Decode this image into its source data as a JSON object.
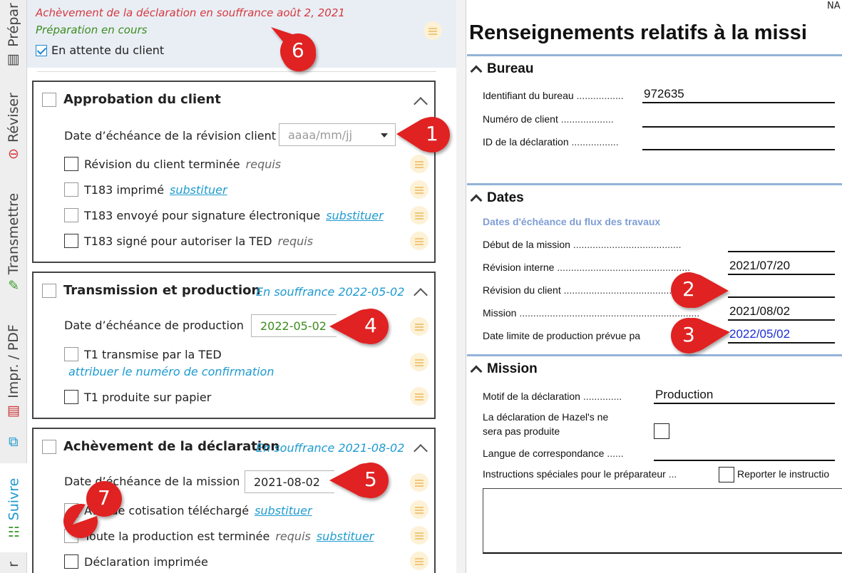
{
  "rail": {
    "tabs": [
      {
        "label": "Prépar",
        "icon": "chart-icon"
      },
      {
        "label": "Réviser",
        "icon": "minus-circle-icon"
      },
      {
        "label": "Transmettre",
        "icon": "send-icon"
      },
      {
        "label": "Impr. / PDF",
        "icon": "pdf-icon"
      },
      {
        "label": "",
        "icon": "copy-icon"
      },
      {
        "label": "Suivre",
        "icon": "workflow-icon"
      },
      {
        "label": "r",
        "icon": ""
      }
    ]
  },
  "status": {
    "overdue_text": "Achèvement de la déclaration en souffrance  août 2, 2021",
    "prep_text": "Préparation en cours",
    "waiting_label": "En attente du client"
  },
  "sections": [
    {
      "title": "Approbation du client",
      "status": "",
      "date_label": "Date d’échéance de la révision client",
      "date_placeholder": "aaaa/mm/jj",
      "items": [
        {
          "label": "Révision du client terminée",
          "tag": "requis",
          "link": ""
        },
        {
          "label": "T183 imprimé",
          "tag": "",
          "link": "substituer"
        },
        {
          "label": "T183 envoyé pour signature électronique",
          "tag": "",
          "link": "substituer"
        },
        {
          "label": "T183 signé pour autoriser la TED",
          "tag": "requis",
          "link": ""
        }
      ]
    },
    {
      "title": "Transmission et production",
      "status": "En souffrance 2022-05-02",
      "date_label": "Date d’échéance de production",
      "date_value": "2022-05-02",
      "items": [
        {
          "label": "T1 transmise par la TED",
          "tag": "",
          "link": "",
          "sublink": "attribuer le numéro de confirmation"
        },
        {
          "label": "T1 produite sur papier",
          "tag": "",
          "link": ""
        }
      ]
    },
    {
      "title": "Achèvement de la déclaration",
      "status": "En souffrance 2021-08-02",
      "date_label": "Date d’échéance de la mission",
      "date_value": "2021-08-02",
      "items": [
        {
          "label": "Avis de cotisation téléchargé",
          "tag": "",
          "link": "substituer"
        },
        {
          "label": "Toute la production est terminée",
          "tag": "requis",
          "link": "substituer"
        },
        {
          "label": "Déclaration imprimée",
          "tag": "",
          "link": ""
        }
      ]
    }
  ],
  "form": {
    "corner_text": "NA",
    "title": "Renseignements relatifs à la missi",
    "bureau": {
      "heading": "Bureau",
      "fields": [
        {
          "label": "Identifiant du bureau",
          "value": "972635"
        },
        {
          "label": "Numéro de client",
          "value": ""
        },
        {
          "label": "ID de la déclaration",
          "value": ""
        }
      ]
    },
    "dates": {
      "heading": "Dates",
      "subheading": "Dates d'échéance du flux des travaux",
      "fields": [
        {
          "label": "Début de la mission",
          "value": ""
        },
        {
          "label": "Révision interne",
          "value": "2021/07/20"
        },
        {
          "label": "Révision du client",
          "value": ""
        },
        {
          "label": "Mission",
          "value": "2021/08/02"
        },
        {
          "label": "Date limite de production prévue pa",
          "value": "2022/05/02"
        }
      ]
    },
    "mission": {
      "heading": "Mission",
      "motif_label": "Motif de la déclaration",
      "motif_value": "Production",
      "not_filed_label_1": "La déclaration de Hazel's ne",
      "not_filed_label_2": "sera pas produite",
      "language_label": "Langue de correspondance",
      "language_value": "",
      "instructions_label": "Instructions spéciales pour le préparateur",
      "report_label": "Reporter le instructio"
    }
  },
  "callouts": [
    "1",
    "2",
    "3",
    "4",
    "5",
    "6",
    "7"
  ],
  "colors": {
    "callout": "#e02424",
    "accent": "#1e9bd0",
    "overdue": "#d6383f",
    "progress": "#3c8c1e",
    "form_rule": "#93b3d8"
  }
}
